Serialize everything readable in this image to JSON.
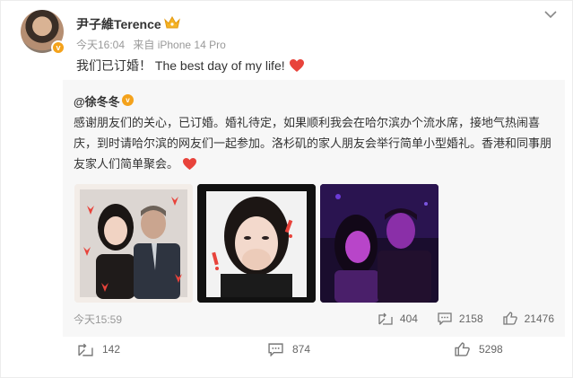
{
  "post": {
    "author": "尹子維Terence",
    "verified_badge": "v",
    "time": "今天16:04",
    "source": "来自 iPhone 14 Pro",
    "text": "我们已订婚！ The best day of my life!"
  },
  "quoted": {
    "author": "@徐冬冬",
    "verified_badge": "v",
    "text": "感谢朋友们的关心，已订婚。婚礼待定，如果顺利我会在哈尔滨办个流水席，接地气热闹喜庆，到时请哈尔滨的网友们一起参加。洛杉矶的家人朋友会举行简单小型婚礼。香港和同事朋友家人们简单聚会。",
    "time": "今天15:59",
    "reposts": "404",
    "comments": "2158",
    "likes": "21476",
    "images": [
      "couple-selfie-photo",
      "woman-hand-over-mouth-photo",
      "couple-purple-light-photo"
    ]
  },
  "footer": {
    "reposts": "142",
    "comments": "874",
    "likes": "5298"
  },
  "colors": {
    "heart": "#e8433b",
    "badge": "#f4a21b",
    "quote_bg": "#f7f7f7",
    "muted": "#999999"
  }
}
